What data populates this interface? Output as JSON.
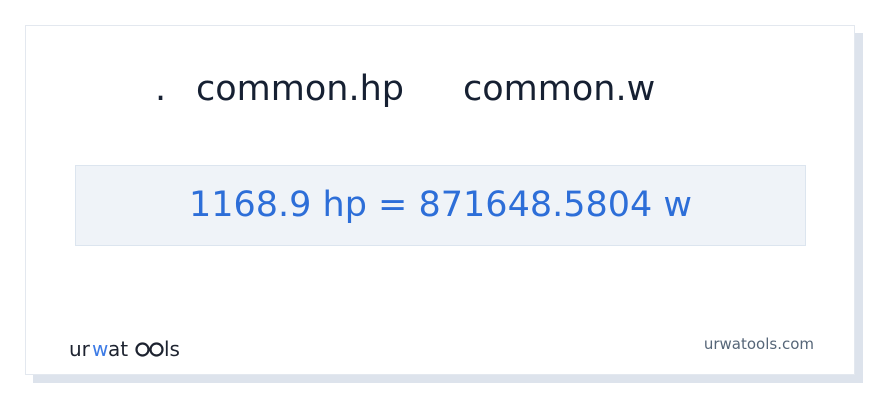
{
  "conversion": {
    "dot": ".",
    "from_unit": "common.hp",
    "to_unit": "common.w"
  },
  "result": {
    "text": "1168.9 hp = 871648.5804 w"
  },
  "brand": {
    "logo_text": "urwatools",
    "site_url": "urwatools.com"
  },
  "colors": {
    "result_text": "#2d6ed8",
    "logo_accent": "#3d7be6",
    "heading": "#162032"
  }
}
